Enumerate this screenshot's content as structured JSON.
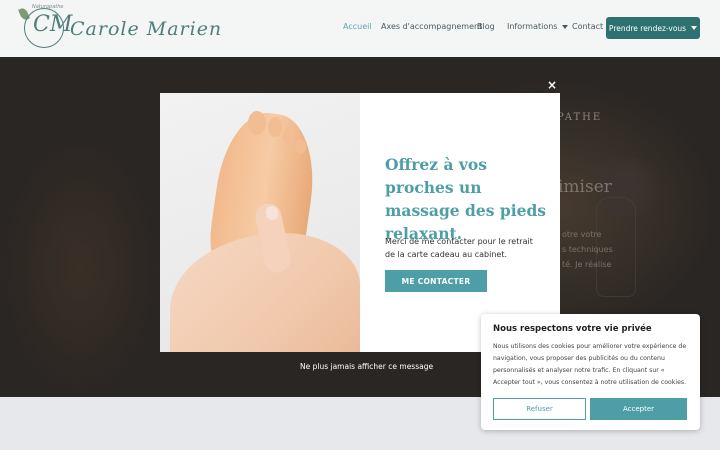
{
  "header": {
    "logo_name": "Carole Marien",
    "logo_monogram": "CM",
    "logo_tagline": "Naturopathe",
    "nav": [
      {
        "label": "Accueil",
        "active": true
      },
      {
        "label": "Axes d'accompagnement",
        "active": false
      },
      {
        "label": "Blog",
        "active": false
      },
      {
        "label": "Informations",
        "active": false,
        "dropdown": true
      },
      {
        "label": "Contact",
        "active": false
      }
    ],
    "cta_label": "Prendre rendez-vous"
  },
  "hero": {
    "kicker": "PATHE",
    "headline_fragment": "imiser",
    "lines": [
      "otre votre",
      "s techniques",
      "té. Je réalise"
    ]
  },
  "popup": {
    "title": "Offrez à vos proches un massage des pieds relaxant.",
    "text": "Merci de me contacter pour le retrait de la carte cadeau au cabinet.",
    "button_label": "ME CONTACTER",
    "close_label": "×",
    "never_show_label": "Ne plus jamais afficher ce message"
  },
  "cookie": {
    "title": "Nous respectons votre vie privée",
    "text": "Nous utilisons des cookies pour améliorer votre expérience de navigation, vous proposer des publicités ou du contenu personnalisés et analyser notre trafic. En cliquant sur « Accepter tout », vous consentez à notre utilisation de cookies.",
    "reject_label": "Refuser",
    "accept_label": "Accepter"
  },
  "colors": {
    "accent": "#4e9ea7",
    "cta": "#2f7171",
    "nav_active": "#5aa7b1"
  }
}
